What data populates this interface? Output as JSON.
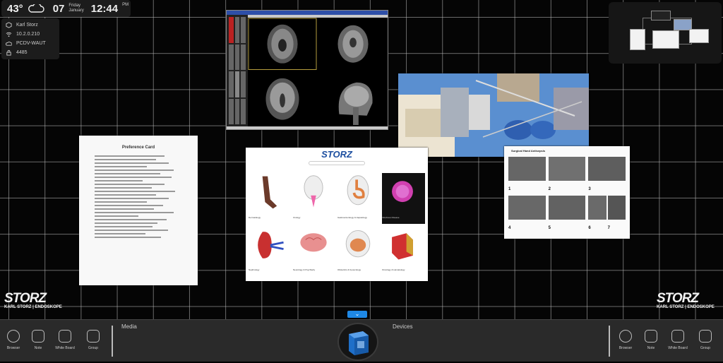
{
  "status": {
    "temperature": "43°",
    "weather_icon": "cloud-icon",
    "date_num": "07",
    "day": "Friday",
    "month": "January",
    "time": "12:44",
    "ampm": "PM"
  },
  "network": [
    {
      "icon": "location-cube-icon",
      "text": "Karl Storz"
    },
    {
      "icon": "wifi-icon",
      "text": "10.2.0.210"
    },
    {
      "icon": "cloud-icon",
      "text": "PCDV-WAUT"
    },
    {
      "icon": "lock-icon",
      "text": "4485"
    }
  ],
  "brand": {
    "logo": "STORZ",
    "sub": "KARL STORZ | ENDOSKOPE"
  },
  "board": {
    "preference_card": {
      "title": "Preference Card"
    },
    "storz_card": {
      "logo": "STORZ",
      "items": [
        "Dermatology",
        "Urology",
        "Gastroenterology & Hepatology",
        "Infectious Disease",
        "Nephrology",
        "Neurology & Psychiatry",
        "Obstetrics & Gynecology",
        "Oncology & Hematology"
      ]
    },
    "handwashing": {
      "title": "Surgical Hand Antisepsis",
      "steps": [
        "1",
        "2",
        "3",
        "4",
        "5",
        "6",
        "7"
      ]
    }
  },
  "taskbar": {
    "left_tools": [
      {
        "icon": "globe-icon",
        "label": "Browser"
      },
      {
        "icon": "note-icon",
        "label": "Note"
      },
      {
        "icon": "whiteboard-icon",
        "label": "White Board"
      },
      {
        "icon": "group-icon",
        "label": "Group"
      }
    ],
    "media_label": "Media",
    "devices_label": "Devices",
    "right_tools": [
      {
        "icon": "globe-icon",
        "label": "Browser"
      },
      {
        "icon": "note-icon",
        "label": "Note"
      },
      {
        "icon": "whiteboard-icon",
        "label": "White Board"
      },
      {
        "icon": "group-icon",
        "label": "Group"
      }
    ],
    "expand_glyph": "⌄"
  },
  "colors": {
    "accent": "#1e88e5",
    "grid": "#bebebe",
    "background": "#050505"
  }
}
